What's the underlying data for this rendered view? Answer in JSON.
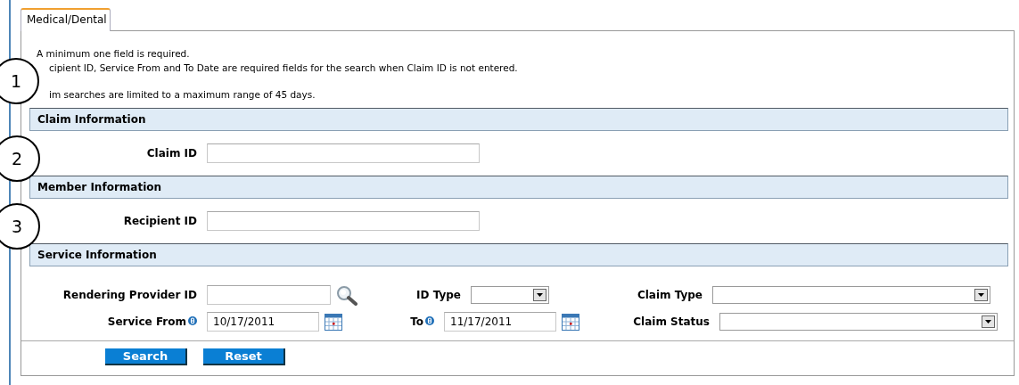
{
  "tabs": [
    {
      "label": "Medical/Dental",
      "selected": true
    }
  ],
  "notes": {
    "lines": [
      {
        "text": "A minimum one field is required.",
        "indent": false
      },
      {
        "text": "cipient ID, Service From and To Date are required fields for the search when Claim ID is not entered.",
        "indent": true
      },
      {
        "text": "im searches are limited to a maximum range of 45 days.",
        "indent": true
      }
    ],
    "callout": "1"
  },
  "sections": [
    {
      "title": "Claim Information",
      "callout": "2",
      "rows": [
        [
          {
            "kind": "text",
            "label": "Claim ID"
          }
        ]
      ]
    },
    {
      "title": "Member Information",
      "callout": "3",
      "rows": [
        [
          {
            "kind": "text",
            "label": "Recipient ID"
          }
        ]
      ]
    },
    {
      "title": "Service Information",
      "rows": [
        [
          {
            "kind": "lookup",
            "label": "Rendering Provider ID"
          },
          {
            "kind": "select",
            "label": "ID Type"
          },
          {
            "kind": "select",
            "label": "Claim Type"
          }
        ],
        [
          {
            "kind": "date",
            "label": "Service From",
            "info": true,
            "value": "10/17/2011"
          },
          {
            "kind": "date",
            "label": "To",
            "info": true,
            "value": "11/17/2011"
          },
          {
            "kind": "select",
            "label": "Claim Status"
          }
        ]
      ]
    }
  ],
  "buttons": [
    "Search",
    "Reset"
  ]
}
